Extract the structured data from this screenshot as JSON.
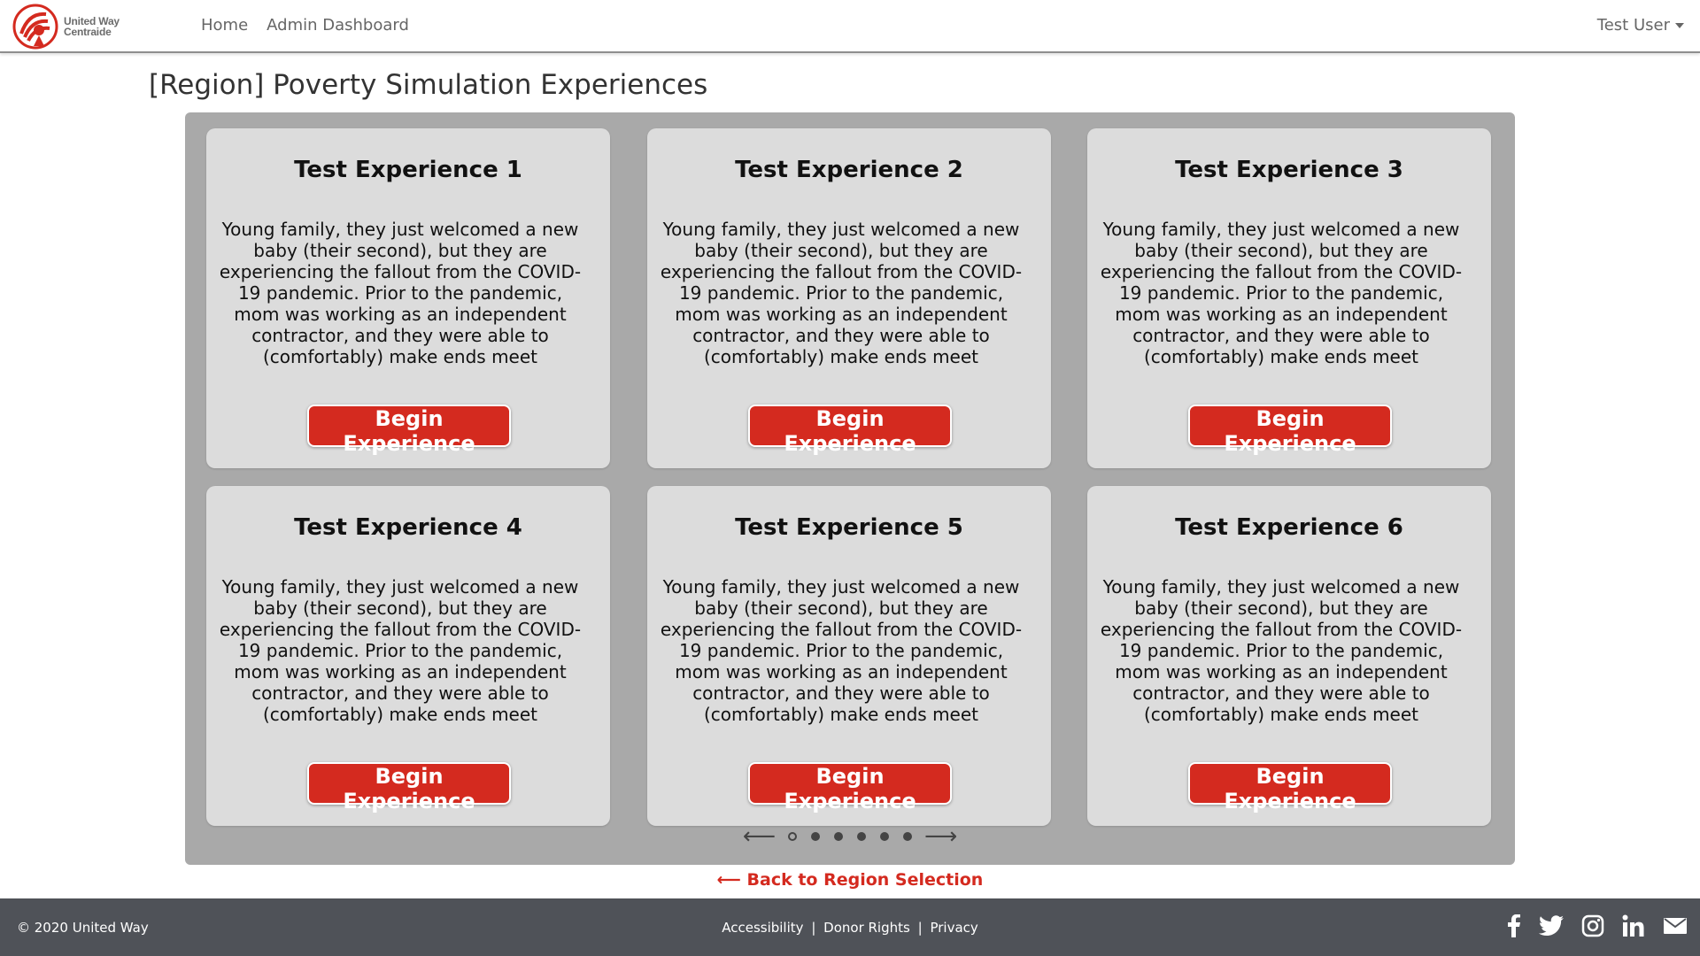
{
  "brand": {
    "line1": "United Way",
    "line2": "Centraide",
    "logo_icon": "united-way-logo",
    "logo_color": "#d42a1f"
  },
  "nav": {
    "items": [
      {
        "label": "Home"
      },
      {
        "label": "Admin Dashboard"
      }
    ],
    "user": "Test User"
  },
  "page": {
    "title": "[Region] Poverty Simulation Experiences"
  },
  "cards": [
    {
      "title": "Test Experience 1",
      "description": "Young family, they just welcomed a new baby (their second), but they are experiencing the fallout from the COVID-19 pandemic. Prior to the pandemic, mom was working as an independent contractor, and they were able to (comfortably) make ends meet",
      "button": "Begin Experience"
    },
    {
      "title": "Test Experience 2",
      "description": "Young family, they just welcomed a new baby (their second), but they are experiencing the fallout from the COVID-19 pandemic. Prior to the pandemic, mom was working as an independent contractor, and they were able to (comfortably) make ends meet",
      "button": "Begin Experience"
    },
    {
      "title": "Test Experience 3",
      "description": "Young family, they just welcomed a new baby (their second), but they are experiencing the fallout from the COVID-19 pandemic. Prior to the pandemic, mom was working as an independent contractor, and they were able to (comfortably) make ends meet",
      "button": "Begin Experience"
    },
    {
      "title": "Test Experience 4",
      "description": "Young family, they just welcomed a new baby (their second), but they are experiencing the fallout from the COVID-19 pandemic. Prior to the pandemic, mom was working as an independent contractor, and they were able to (comfortably) make ends meet",
      "button": "Begin Experience"
    },
    {
      "title": "Test Experience 5",
      "description": "Young family, they just welcomed a new baby (their second), but they are experiencing the fallout from the COVID-19 pandemic. Prior to the pandemic, mom was working as an independent contractor, and they were able to (comfortably) make ends meet",
      "button": "Begin Experience"
    },
    {
      "title": "Test Experience 6",
      "description": "Young family, they just welcomed a new baby (their second), but they are experiencing the fallout from the COVID-19 pandemic. Prior to the pandemic, mom was working as an independent contractor, and they were able to (comfortably) make ends meet",
      "button": "Begin Experience"
    }
  ],
  "carousel": {
    "prev_icon": "arrow-left-icon",
    "next_icon": "arrow-right-icon",
    "prev_glyph": "⟵",
    "next_glyph": "⟶",
    "dots": 6,
    "active_dot": 0
  },
  "back_link": "⟵ Back to Region Selection",
  "footer": {
    "copyright": "© 2020 United Way",
    "links": [
      {
        "label": "Accessibility"
      },
      {
        "label": "Donor Rights"
      },
      {
        "label": "Privacy"
      }
    ],
    "separator": "|",
    "social_icons": [
      "facebook-icon",
      "twitter-icon",
      "instagram-icon",
      "linkedin-icon",
      "mail-icon"
    ]
  },
  "colors": {
    "accent": "#d42a1f",
    "footer_bg": "#4f5258",
    "carousel_bg": "#a9a9a9",
    "card_bg": "#dcdcdc"
  }
}
